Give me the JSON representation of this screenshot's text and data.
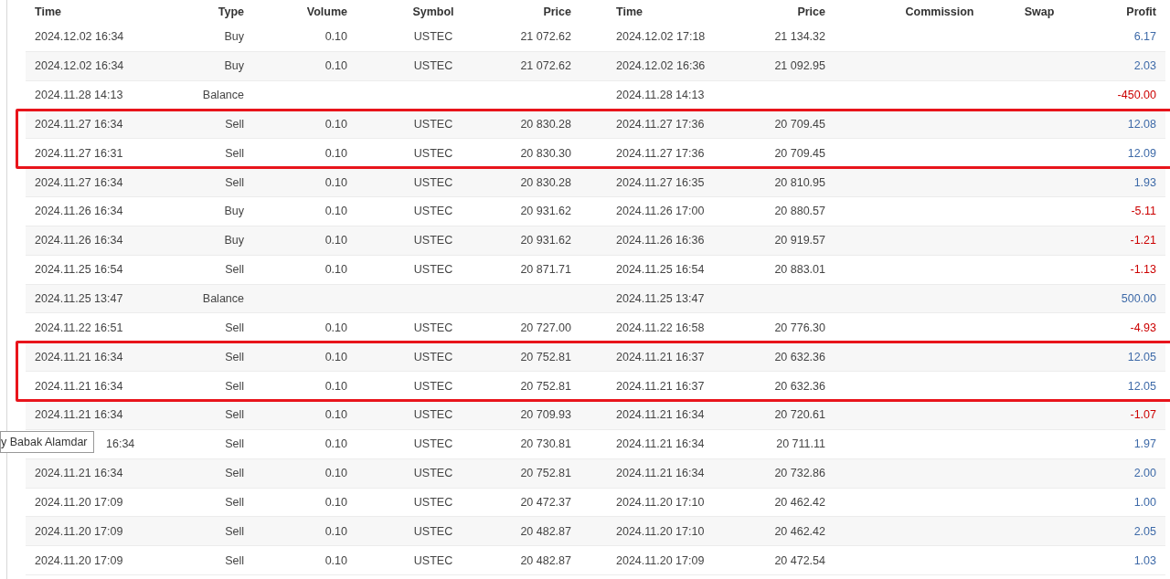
{
  "table": {
    "columns": [
      "Time",
      "Type",
      "Volume",
      "Symbol",
      "Price",
      "Time",
      "Price",
      "Commission",
      "Swap",
      "Profit"
    ],
    "rows": [
      {
        "open_time": "2024.12.02 16:34",
        "type": "Buy",
        "volume": "0.10",
        "symbol": "USTEC",
        "open_price": "21 072.62",
        "close_time": "2024.12.02 17:18",
        "close_price": "21 134.32",
        "profit": "6.17",
        "loss": false,
        "highlighted": false
      },
      {
        "open_time": "2024.12.02 16:34",
        "type": "Buy",
        "volume": "0.10",
        "symbol": "USTEC",
        "open_price": "21 072.62",
        "close_time": "2024.12.02 16:36",
        "close_price": "21 092.95",
        "profit": "2.03",
        "loss": false,
        "highlighted": false
      },
      {
        "open_time": "2024.11.28 14:13",
        "type": "Balance",
        "close_time": "2024.11.28 14:13",
        "profit": "-450.00",
        "loss": true,
        "highlighted": false
      },
      {
        "open_time": "2024.11.27 16:34",
        "type": "Sell",
        "volume": "0.10",
        "symbol": "USTEC",
        "open_price": "20 830.28",
        "close_time": "2024.11.27 17:36",
        "close_price": "20 709.45",
        "profit": "12.08",
        "loss": false,
        "highlighted": true
      },
      {
        "open_time": "2024.11.27 16:31",
        "type": "Sell",
        "volume": "0.10",
        "symbol": "USTEC",
        "open_price": "20 830.30",
        "close_time": "2024.11.27 17:36",
        "close_price": "20 709.45",
        "profit": "12.09",
        "loss": false,
        "highlighted": true
      },
      {
        "open_time": "2024.11.27 16:34",
        "type": "Sell",
        "volume": "0.10",
        "symbol": "USTEC",
        "open_price": "20 830.28",
        "close_time": "2024.11.27 16:35",
        "close_price": "20 810.95",
        "profit": "1.93",
        "loss": false,
        "highlighted": false
      },
      {
        "open_time": "2024.11.26 16:34",
        "type": "Buy",
        "volume": "0.10",
        "symbol": "USTEC",
        "open_price": "20 931.62",
        "close_time": "2024.11.26 17:00",
        "close_price": "20 880.57",
        "profit": "-5.11",
        "loss": true,
        "highlighted": false
      },
      {
        "open_time": "2024.11.26 16:34",
        "type": "Buy",
        "volume": "0.10",
        "symbol": "USTEC",
        "open_price": "20 931.62",
        "close_time": "2024.11.26 16:36",
        "close_price": "20 919.57",
        "profit": "-1.21",
        "loss": true,
        "highlighted": false
      },
      {
        "open_time": "2024.11.25 16:54",
        "type": "Sell",
        "volume": "0.10",
        "symbol": "USTEC",
        "open_price": "20 871.71",
        "close_time": "2024.11.25 16:54",
        "close_price": "20 883.01",
        "profit": "-1.13",
        "loss": true,
        "highlighted": false
      },
      {
        "open_time": "2024.11.25 13:47",
        "type": "Balance",
        "close_time": "2024.11.25 13:47",
        "profit": "500.00",
        "loss": false,
        "highlighted": false
      },
      {
        "open_time": "2024.11.22 16:51",
        "type": "Sell",
        "volume": "0.10",
        "symbol": "USTEC",
        "open_price": "20 727.00",
        "close_time": "2024.11.22 16:58",
        "close_price": "20 776.30",
        "profit": "-4.93",
        "loss": true,
        "highlighted": false
      },
      {
        "open_time": "2024.11.21 16:34",
        "type": "Sell",
        "volume": "0.10",
        "symbol": "USTEC",
        "open_price": "20 752.81",
        "close_time": "2024.11.21 16:37",
        "close_price": "20 632.36",
        "profit": "12.05",
        "loss": false,
        "highlighted": true
      },
      {
        "open_time": "2024.11.21 16:34",
        "type": "Sell",
        "volume": "0.10",
        "symbol": "USTEC",
        "open_price": "20 752.81",
        "close_time": "2024.11.21 16:37",
        "close_price": "20 632.36",
        "profit": "12.05",
        "loss": false,
        "highlighted": true
      },
      {
        "open_time": "2024.11.21 16:34",
        "type": "Sell",
        "volume": "0.10",
        "symbol": "USTEC",
        "open_price": "20 709.93",
        "close_time": "2024.11.21 16:34",
        "close_price": "20 720.61",
        "profit": "-1.07",
        "loss": true,
        "highlighted": false
      },
      {
        "open_time": "16:34",
        "open_time_covered": true,
        "type": "Sell",
        "volume": "0.10",
        "symbol": "USTEC",
        "open_price": "20 730.81",
        "close_time": "2024.11.21 16:34",
        "close_price": "20 711.11",
        "profit": "1.97",
        "loss": false,
        "highlighted": false
      },
      {
        "open_time": "2024.11.21 16:34",
        "type": "Sell",
        "volume": "0.10",
        "symbol": "USTEC",
        "open_price": "20 752.81",
        "close_time": "2024.11.21 16:34",
        "close_price": "20 732.86",
        "profit": "2.00",
        "loss": false,
        "highlighted": false
      },
      {
        "open_time": "2024.11.20 17:09",
        "type": "Sell",
        "volume": "0.10",
        "symbol": "USTEC",
        "open_price": "20 472.37",
        "close_time": "2024.11.20 17:10",
        "close_price": "20 462.42",
        "profit": "1.00",
        "loss": false,
        "highlighted": false
      },
      {
        "open_time": "2024.11.20 17:09",
        "type": "Sell",
        "volume": "0.10",
        "symbol": "USTEC",
        "open_price": "20 482.87",
        "close_time": "2024.11.20 17:10",
        "close_price": "20 462.42",
        "profit": "2.05",
        "loss": false,
        "highlighted": false
      },
      {
        "open_time": "2024.11.20 17:09",
        "type": "Sell",
        "volume": "0.10",
        "symbol": "USTEC",
        "open_price": "20 482.87",
        "close_time": "2024.11.20 17:09",
        "close_price": "20 472.54",
        "profit": "1.03",
        "loss": false,
        "highlighted": false
      }
    ]
  },
  "tooltip": {
    "text": "y Babak Alamdar"
  }
}
